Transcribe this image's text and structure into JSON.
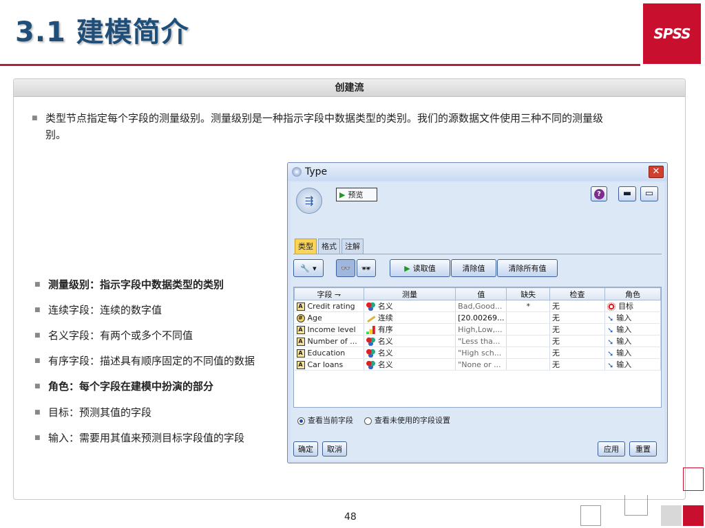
{
  "slide": {
    "title": "3.1 建模简介",
    "logo": "SPSS",
    "page_number": "48",
    "brand_color": "#c8102e"
  },
  "panel": {
    "header": "创建流",
    "intro": "类型节点指定每个字段的测量级别。测量级别是一种指示字段中数据类型的类别。我们的源数据文件使用三种不同的测量级别。",
    "bullets": [
      {
        "text": "测量级别：指示字段中数据类型的类别",
        "bold": true
      },
      {
        "text": "连续字段：连续的数字值",
        "bold": false
      },
      {
        "text": "名义字段：有两个或多个不同值",
        "bold": false
      },
      {
        "text": "有序字段：描述具有顺序固定的不同值的数据",
        "bold": false
      },
      {
        "text": "角色：每个字段在建模中扮演的部分",
        "bold": true
      },
      {
        "text": "目标：预测其值的字段",
        "bold": false
      },
      {
        "text": "输入：需要用其值来预测目标字段值的字段",
        "bold": false
      }
    ]
  },
  "dialog": {
    "title": "Type",
    "close": "✕",
    "preview_label": "预览",
    "help": "?",
    "minimize": "▬",
    "maximize": "▭",
    "tabs": [
      "类型",
      "格式",
      "注解"
    ],
    "toolbar": {
      "read_values": "读取值",
      "clear_values": "清除值",
      "clear_all_values": "清除所有值"
    },
    "columns": [
      "字段",
      "测量",
      "值",
      "缺失",
      "检查",
      "角色"
    ],
    "rows": [
      {
        "field": "Credit rating",
        "field_icon": "A",
        "measure": "名义",
        "measure_icon": "nominal",
        "values": "Bad,Good...",
        "missing": "*",
        "check": "无",
        "role": "目标",
        "role_icon": "target"
      },
      {
        "field": "Age",
        "field_icon": "#",
        "measure": "连续",
        "measure_icon": "continuous",
        "values": "[20.00269...",
        "missing": "",
        "check": "无",
        "role": "输入",
        "role_icon": "input"
      },
      {
        "field": "Income level",
        "field_icon": "A",
        "measure": "有序",
        "measure_icon": "ordinal",
        "values": "High,Low,...",
        "missing": "",
        "check": "无",
        "role": "输入",
        "role_icon": "input"
      },
      {
        "field": "Number of ...",
        "field_icon": "A",
        "measure": "名义",
        "measure_icon": "nominal",
        "values": "\"Less tha...",
        "missing": "",
        "check": "无",
        "role": "输入",
        "role_icon": "input"
      },
      {
        "field": "Education",
        "field_icon": "A",
        "measure": "名义",
        "measure_icon": "nominal",
        "values": "\"High sch...",
        "missing": "",
        "check": "无",
        "role": "输入",
        "role_icon": "input"
      },
      {
        "field": "Car loans",
        "field_icon": "A",
        "measure": "名义",
        "measure_icon": "nominal",
        "values": "\"None or ...",
        "missing": "",
        "check": "无",
        "role": "输入",
        "role_icon": "input"
      }
    ],
    "radio": {
      "current_fields": "查看当前字段",
      "unused_fields": "查看未使用的字段设置",
      "selected": "current_fields"
    },
    "buttons": {
      "ok": "确定",
      "cancel": "取消",
      "apply": "应用",
      "reset": "重置"
    }
  }
}
